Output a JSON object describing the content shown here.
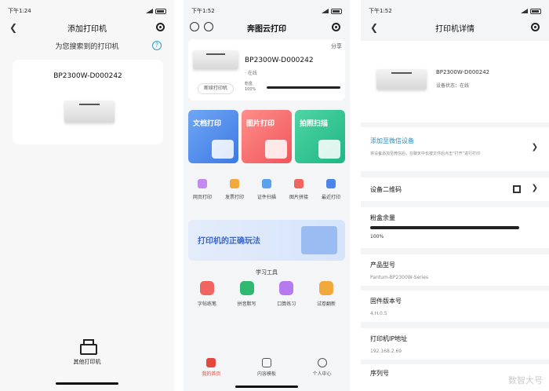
{
  "panel1": {
    "status_time": "下午1:24",
    "title": "添加打印机",
    "found_label": "为您搜索到的打印机",
    "help_symbol": "?",
    "device_name": "BP2300W-D000242",
    "other_printer_label": "其他打印机",
    "icons": [
      "back-icon",
      "target-icon",
      "help-icon",
      "printer-icon"
    ]
  },
  "panel2": {
    "status_time": "下午1:52",
    "title": "奔图云打印",
    "share_label": "分享",
    "device_name": "BP2300W-D000242",
    "online_label": "· 在线",
    "connect_label": "断续打印机",
    "toner_label": "粉盒",
    "toner_percent": "100%",
    "tiles": [
      "文档打印",
      "图片打印",
      "拍照扫描"
    ],
    "sub_functions": [
      "网页打印",
      "发票打印",
      "证件扫描",
      "图片拼接",
      "最近打印"
    ],
    "banner_text": "打印机的正确玩法",
    "tools_title": "学习工具",
    "tools": [
      "字帖练笔",
      "拼音默写",
      "口算练习",
      "试卷翻新"
    ],
    "tabs": [
      "我的首页",
      "内容模板",
      "个人中心"
    ],
    "colors": {
      "doc": "#4a86ea",
      "img": "#f0565b",
      "scan": "#1fb785",
      "accent": "#e2483d"
    }
  },
  "panel3": {
    "status_time": "下午1:52",
    "title": "打印机详情",
    "device_name": "BP2300W-D000242",
    "device_state": "设备状态：在线",
    "add_wechat_title": "添加至微信设备",
    "add_wechat_desc": "将设备添加至微信后，在聊天中长按文件后点击“打开”进行打印",
    "qr_label": "设备二维码",
    "toner_title": "粉盒余量",
    "toner_value": "100%",
    "model_title": "产品型号",
    "model_value": "Pantum-BP2300W-Series",
    "firmware_title": "固件版本号",
    "firmware_value": "4.H.0.5",
    "ip_title": "打印机IP地址",
    "ip_value": "192.168.2.69",
    "serial_title": "序列号",
    "watermark": "数智大号"
  }
}
